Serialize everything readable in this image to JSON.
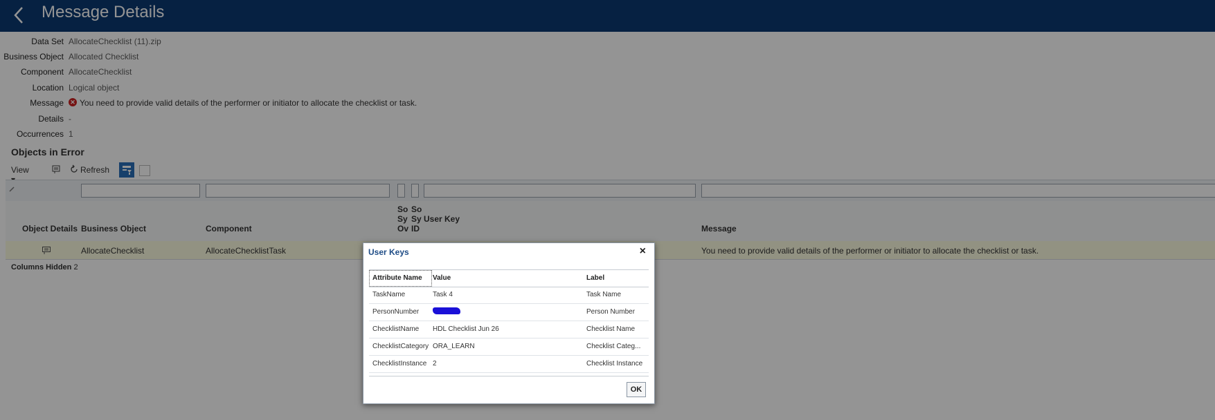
{
  "header": {
    "title": "Message Details"
  },
  "details": [
    {
      "label": "Data Set",
      "value": "AllocateChecklist (11).zip"
    },
    {
      "label": "Business Object",
      "value": "Allocated Checklist"
    },
    {
      "label": "Component",
      "value": "AllocateChecklist"
    },
    {
      "label": "Location",
      "value": "Logical object"
    },
    {
      "label": "Message",
      "value": "You need to provide valid details of the performer or initiator to allocate the checklist or task."
    },
    {
      "label": "Details",
      "value": "-"
    },
    {
      "label": "Occurrences",
      "value": "1"
    }
  ],
  "objects": {
    "title": "Objects in Error",
    "toolbar": {
      "view": "View ▾",
      "refresh": "Refresh"
    },
    "columns": {
      "object_details": "Object Details",
      "business_object": "Business Object",
      "component": "Component",
      "so_sy_ov_1": "So",
      "so_sy_ov_2": "Sy",
      "so_sy_ov_3": "Ov",
      "so_sy_id_1": "So",
      "so_sy_id_2": "Sy",
      "so_sy_id_3": "ID",
      "user_key": "User Key",
      "message": "Message"
    },
    "rows": [
      {
        "business_object": "AllocateChecklist",
        "component": "AllocateChecklistTask",
        "message": "You need to provide valid details of the performer or initiator to allocate the checklist or task."
      }
    ],
    "columns_hidden_label": "Columns Hidden",
    "columns_hidden_count": "2"
  },
  "dialog": {
    "title": "User Keys",
    "close": "×",
    "headers": {
      "attribute": "Attribute Name",
      "value": "Value",
      "label": "Label"
    },
    "rows": [
      {
        "attribute": "TaskName",
        "value": "Task 4",
        "label": "Task Name"
      },
      {
        "attribute": "PersonNumber",
        "value": "",
        "label": "Person Number",
        "redacted": true
      },
      {
        "attribute": "ChecklistName",
        "value": "HDL Checklist Jun 26",
        "label": "Checklist Name"
      },
      {
        "attribute": "ChecklistCategory",
        "value": "ORA_LEARN",
        "label": "Checklist Categ..."
      },
      {
        "attribute": "ChecklistInstance",
        "value": "2",
        "label": "Checklist Instance"
      }
    ],
    "ok_label": "OK"
  },
  "colors": {
    "header_bg": "#0b3a73",
    "accent": "#2a6fb9",
    "error": "#cc2222",
    "redaction": "#1a10d8"
  }
}
